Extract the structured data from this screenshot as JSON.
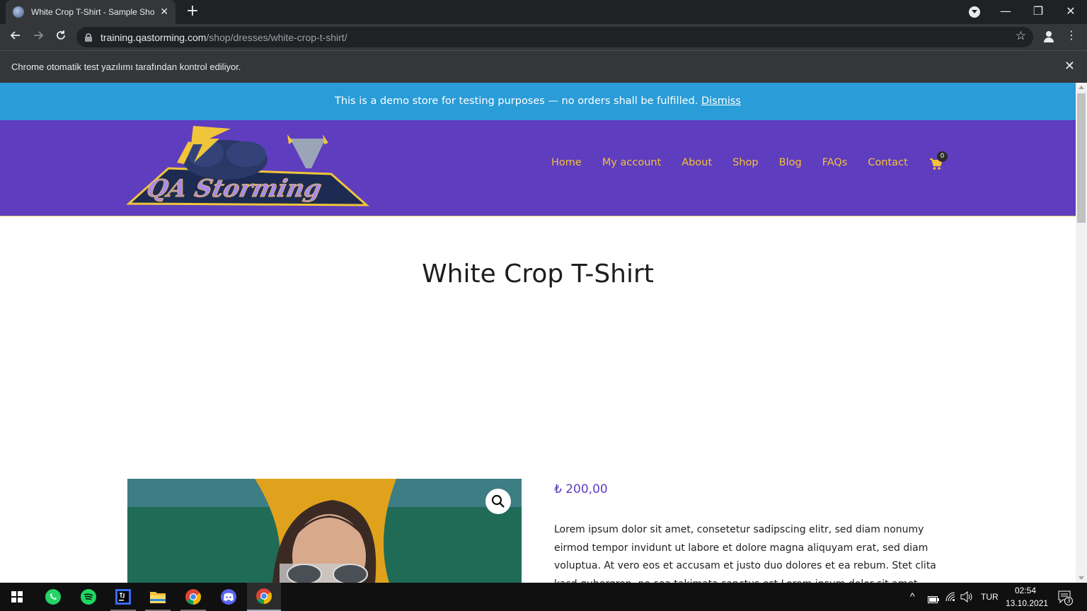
{
  "browser": {
    "tab_title": "White Crop T-Shirt - Sample Shop",
    "tab_close": "✕",
    "new_tab": "+",
    "url_host": "training.qastorming.com",
    "url_path": "/shop/dresses/white-crop-t-shirt/",
    "infobar_text": "Chrome otomatik test yazılımı tarafından kontrol ediliyor.",
    "infobar_close": "✕",
    "window_controls": {
      "minimize": "—",
      "restore": "❐",
      "close": "✕"
    }
  },
  "site": {
    "demo_notice": "This is a demo store for testing purposes — no orders shall be fulfilled.",
    "dismiss_label": "Dismiss",
    "logo_text": "QA Storming",
    "nav": [
      "Home",
      "My account",
      "About",
      "Shop",
      "Blog",
      "FAQs",
      "Contact"
    ],
    "cart_count": "0"
  },
  "product": {
    "title": "White Crop T-Shirt",
    "price": "₺ 200,00",
    "description": "Lorem ipsum dolor sit amet, consetetur sadipscing elitr, sed diam nonumy eirmod tempor invidunt ut labore et dolore magna aliquyam erat, sed diam voluptua. At vero eos et accusam et justo duo dolores et ea rebum. Stet clita kasd gubergren, no sea takimata sanctus est Lorem ipsum dolor sit amet."
  },
  "taskbar": {
    "apps": [
      "whatsapp-icon",
      "spotify-icon",
      "intellij-icon",
      "file-explorer-icon",
      "chrome-icon",
      "discord-icon",
      "chrome-icon"
    ],
    "language": "TUR",
    "time": "02:54",
    "date": "13.10.2021",
    "notification_count": "3"
  },
  "colors": {
    "header_purple": "#5e3dbf",
    "nav_gold": "#f3c13a",
    "demo_blue": "#2a9cd7",
    "price_purple": "#5e3dbf"
  }
}
